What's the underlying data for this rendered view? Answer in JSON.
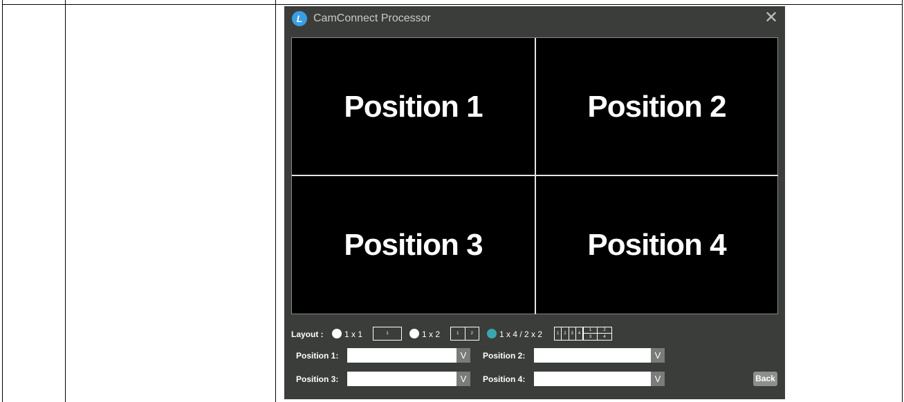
{
  "window": {
    "title": "CamConnect Processor",
    "logo_letter": "L",
    "close_icon": "close-icon"
  },
  "video": {
    "positions": [
      "Position 1",
      "Position 2",
      "Position 3",
      "Position 4"
    ]
  },
  "layout": {
    "label": "Layout :",
    "options": [
      {
        "label": "1 x 1",
        "icon_cells": [
          "1"
        ],
        "selected": false
      },
      {
        "label": "1 x 2",
        "icon_cells": [
          "1",
          "2"
        ],
        "selected": false
      },
      {
        "label": "1 x 4 / 2 x 2",
        "icon_cells": [
          "1",
          "2",
          "3",
          "4"
        ],
        "icon_grid_cells": [
          "1",
          "2",
          "3",
          "4"
        ],
        "selected": true
      }
    ],
    "accent_color": "#3aa7b0"
  },
  "selectors": [
    {
      "label": "Position 1:",
      "value": ""
    },
    {
      "label": "Position 2:",
      "value": ""
    },
    {
      "label": "Position 3:",
      "value": ""
    },
    {
      "label": "Position 4:",
      "value": ""
    }
  ],
  "dropdown_arrow": "V",
  "back_button": "Back"
}
